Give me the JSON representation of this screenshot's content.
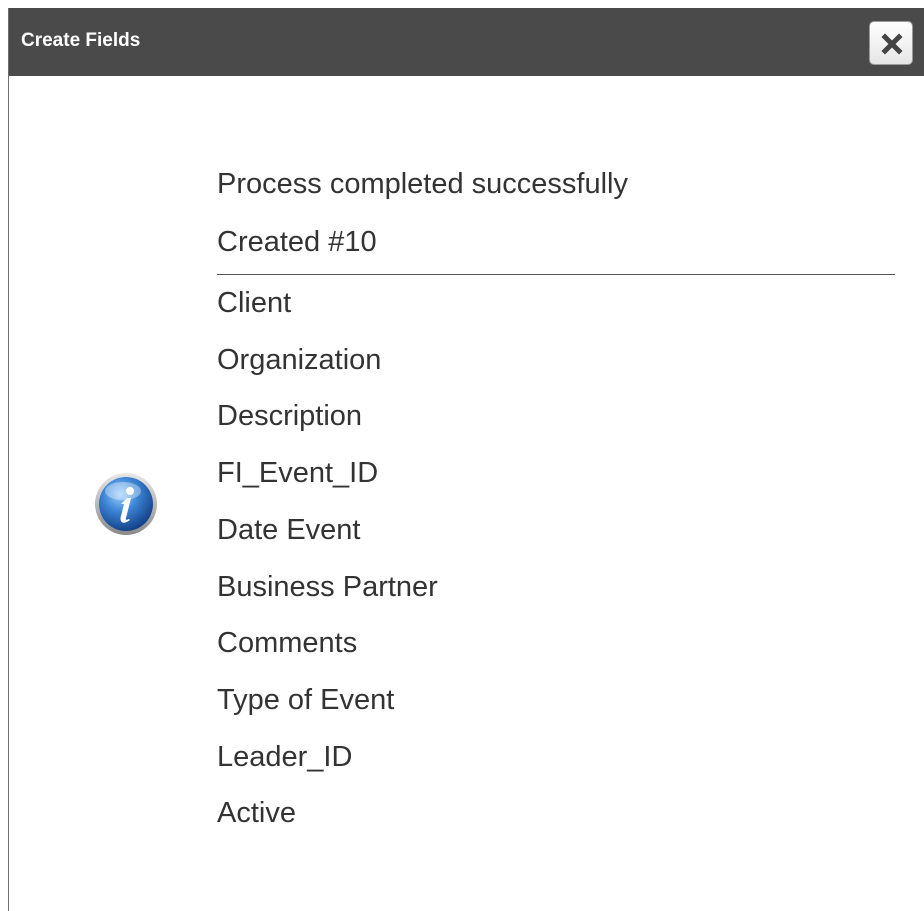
{
  "dialog": {
    "title": "Create Fields",
    "close_icon": "close-x-icon",
    "info_icon": "info-icon"
  },
  "message": {
    "status": "Process completed successfully",
    "created": "Created #10"
  },
  "fields": [
    "Client",
    "Organization",
    "Description",
    "FI_Event_ID",
    "Date Event",
    "Business Partner",
    "Comments",
    "Type of Event",
    "Leader_ID",
    "Active"
  ]
}
